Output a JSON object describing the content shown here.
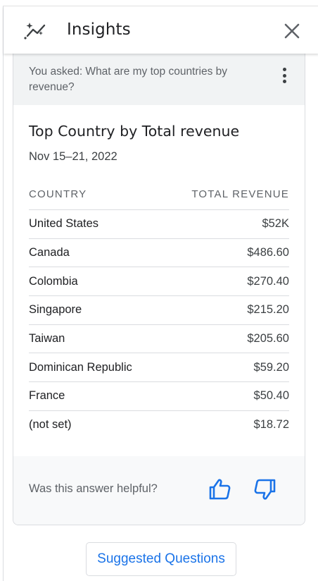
{
  "header": {
    "title": "Insights"
  },
  "question": {
    "text": "You asked: What are my top countries by revenue?"
  },
  "card": {
    "title": "Top Country by Total revenue",
    "date_range": "Nov 15–21, 2022"
  },
  "table": {
    "columns": [
      "COUNTRY",
      "TOTAL REVENUE"
    ],
    "rows": [
      {
        "country": "United States",
        "revenue": "$52K"
      },
      {
        "country": "Canada",
        "revenue": "$486.60"
      },
      {
        "country": "Colombia",
        "revenue": "$270.40"
      },
      {
        "country": "Singapore",
        "revenue": "$215.20"
      },
      {
        "country": "Taiwan",
        "revenue": "$205.60"
      },
      {
        "country": "Dominican Republic",
        "revenue": "$59.20"
      },
      {
        "country": "France",
        "revenue": "$50.40"
      },
      {
        "country": "(not set)",
        "revenue": "$18.72"
      }
    ]
  },
  "feedback": {
    "prompt": "Was this answer helpful?"
  },
  "suggested": {
    "label": "Suggested Questions"
  },
  "colors": {
    "accent": "#1a73e8",
    "question_bg": "#f1f3f4",
    "feedback_bg": "#f8f9fa",
    "divider": "#dadce0"
  },
  "icons": [
    "insights-sparkle-icon",
    "close-icon",
    "more-vert-icon",
    "thumb-up-icon",
    "thumb-down-icon"
  ]
}
